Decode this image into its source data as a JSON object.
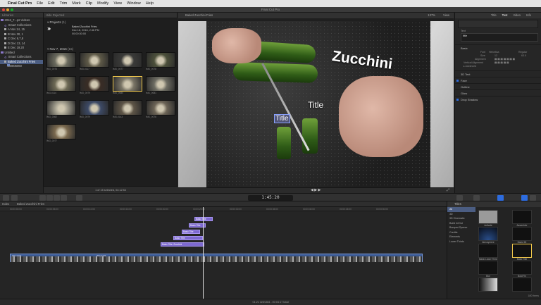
{
  "menubar": {
    "app": "Final Cut Pro",
    "items": [
      "File",
      "Edit",
      "Trim",
      "Mark",
      "Clip",
      "Modify",
      "View",
      "Window",
      "Help"
    ]
  },
  "window": {
    "title": "Final Cut Pro"
  },
  "libraries": {
    "header": "Libraries",
    "rows": [
      {
        "label": "2016_7...ps Videos",
        "type": "library",
        "selected": false
      },
      {
        "label": "Smart Collections",
        "type": "folder",
        "selected": false
      },
      {
        "label": "A Nov 14, 15",
        "type": "event",
        "selected": false
      },
      {
        "label": "B Nov 30, 1",
        "type": "event",
        "selected": false
      },
      {
        "label": "C Dec 6,7,8",
        "type": "event",
        "selected": false
      },
      {
        "label": "D Dec 13, 14",
        "type": "event",
        "selected": false
      },
      {
        "label": "E Dec 19,20",
        "type": "event",
        "selected": false
      },
      {
        "label": "Untitled",
        "type": "library",
        "selected": false
      },
      {
        "label": "Smart Collections",
        "type": "folder",
        "selected": false
      },
      {
        "label": "Baked Zucchini Fries",
        "type": "event",
        "selected": true
      },
      {
        "label": "130806060",
        "type": "clip",
        "selected": false
      }
    ]
  },
  "browser": {
    "header": "Hide Rejected",
    "projects_label": "Projects",
    "projects_count": "(1)",
    "project": {
      "name": "Baked Zucchini Fries",
      "date": "Dec 18, 2016, 2:46 PM",
      "duration": "00:00:30:00"
    },
    "date_section": "Nov 7, 2016",
    "date_count": "(15)",
    "clips": [
      {
        "label": "IMG_0076",
        "tone": "#6b6b5e",
        "selected": false
      },
      {
        "label": "IMG-0117",
        "tone": "#5f5a48",
        "selected": false
      },
      {
        "label": "IMG_0077",
        "tone": "#3a3a38",
        "selected": false
      },
      {
        "label": "IMG_0078",
        "tone": "#4c503a",
        "selected": false
      },
      {
        "label": "IMG-0114",
        "tone": "#6e6a55",
        "selected": false
      },
      {
        "label": "IMG_0079",
        "tone": "#3a2d25",
        "selected": false
      },
      {
        "label": "IMG_0080",
        "tone": "#7a7566",
        "selected": true
      },
      {
        "label": "IMG_0081",
        "tone": "#6d6c62",
        "selected": false
      },
      {
        "label": "IMG_0082",
        "tone": "#a09c8c",
        "selected": false
      },
      {
        "label": "IMG_0079",
        "tone": "#3d4a66",
        "selected": false
      },
      {
        "label": "IMG-0143",
        "tone": "#5e5547",
        "selected": false
      },
      {
        "label": "IMG_0076",
        "tone": "#6c6456",
        "selected": false
      },
      {
        "label": "IMG_0077",
        "tone": "#7b6a4f",
        "selected": false
      }
    ],
    "footer": "1 of 15 selected, 04:12:54"
  },
  "viewer": {
    "clip_title": "Baked Zucchini Fries",
    "zoom": "137%",
    "view_menu": "View",
    "overlay_big": "Zucchini",
    "overlay_title": "Title",
    "overlay_title_selected": "Title"
  },
  "inspector": {
    "tabs": [
      "Title",
      "Text",
      "Video",
      "Info"
    ],
    "active_tab": "Text",
    "text_label": "Text",
    "text_value": "title",
    "basic": "Basic",
    "font_label": "Font",
    "font_value": "Helvetica",
    "style_value": "Regular",
    "size_label": "Size",
    "size_value": "12",
    "size_value2": "63.0",
    "align_label": "Alignment",
    "valign_label": "Vertical Alignment",
    "advanced": "Advanced",
    "sections": [
      {
        "label": "3D Text",
        "checked": false
      },
      {
        "label": "Face",
        "checked": true
      },
      {
        "label": "Outline",
        "checked": false
      },
      {
        "label": "Glow",
        "checked": false
      },
      {
        "label": "Drop Shadow",
        "checked": true
      }
    ]
  },
  "toolbar": {
    "timecode": "1:45:20"
  },
  "timeline": {
    "index": "Index",
    "project_name": "Baked Zucchini Fries",
    "ruler": [
      "00:00:00:00",
      "00:00:05:00",
      "00:00:10:00",
      "00:00:15:00",
      "00:00:20:00",
      "00:00:25:00",
      "00:00:30:00",
      "00:00:35:00",
      "00:00:40:00",
      "00:00:45:00",
      "00:00:50:00"
    ],
    "title_clips": [
      {
        "label": "Basic Title"
      },
      {
        "label": "Basic Title"
      },
      {
        "label": "Basic Title"
      },
      {
        "label": "Basic Title"
      },
      {
        "label": "Basic Title: Zucchini"
      }
    ],
    "primary_clips": [
      "IMG-0133",
      "IMG-0133"
    ]
  },
  "titles_browser": {
    "header": "Titles",
    "categories": [
      "All",
      "3D",
      "3D Cinematic",
      "Build In/Out",
      "Bumper/Opener",
      "Credits",
      "Elements",
      "Lower Thirds"
    ],
    "active_category": "All",
    "items": [
      "Activate",
      "Assembler",
      "Atmosphere",
      "Basic 3D",
      "Basic Lower Third",
      "Basic Title",
      "Blur",
      "Bold Fin",
      "",
      ""
    ],
    "count": "180 items"
  },
  "status": {
    "text": "01:21 selected - 00:04:17 total"
  }
}
